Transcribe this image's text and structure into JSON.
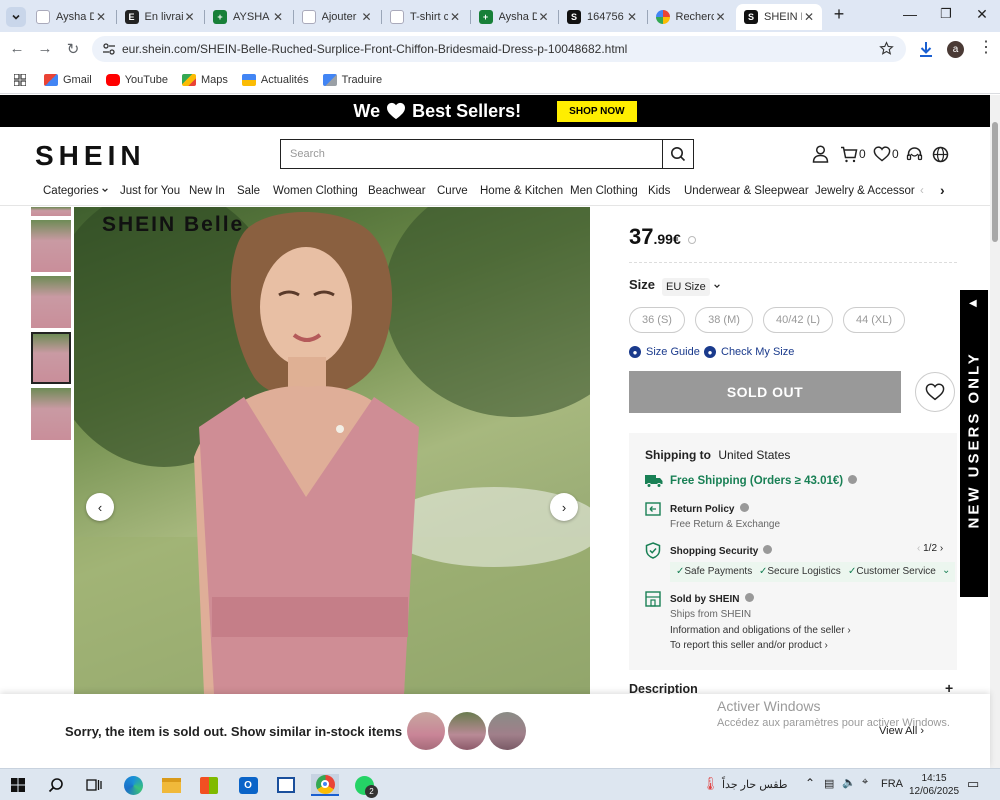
{
  "browser": {
    "tabs": [
      {
        "title": "Aysha D",
        "icon": "pg"
      },
      {
        "title": "En livrai",
        "icon": "e"
      },
      {
        "title": "AYSHA |",
        "icon": "sheet"
      },
      {
        "title": "Ajouter",
        "icon": "pg"
      },
      {
        "title": "T-shirt c",
        "icon": "pg"
      },
      {
        "title": "Aysha D",
        "icon": "sheet"
      },
      {
        "title": "164756",
        "icon": "s"
      },
      {
        "title": "Recherc",
        "icon": "g"
      },
      {
        "title": "SHEIN B",
        "icon": "s"
      }
    ],
    "new_tab": "+",
    "url": "eur.shein.com/SHEIN-Belle-Ruched-Surplice-Front-Chiffon-Bridesmaid-Dress-p-10048682.html",
    "profile_initial": "a",
    "bookmarks": [
      "Gmail",
      "YouTube",
      "Maps",
      "Actualités",
      "Traduire"
    ]
  },
  "promo": {
    "prefix": "We",
    "suffix": "Best Sellers!",
    "button": "SHOP NOW"
  },
  "header": {
    "logo": "SHEIN",
    "search_placeholder": "Search",
    "cart_count": "0",
    "wishlist_count": "0"
  },
  "categories": [
    "Categories",
    "Just for You",
    "New In",
    "Sale",
    "Women Clothing",
    "Beachwear",
    "Curve",
    "Home & Kitchen",
    "Men Clothing",
    "Kids",
    "Underwear & Sleepwear",
    "Jewelry & Accessories"
  ],
  "gallery": {
    "brand_overlay": "SHEIN Belle"
  },
  "product": {
    "price_main": "37",
    "price_cents": ".99€",
    "size_label": "Size",
    "size_system": "EU Size",
    "sizes": [
      "36 (S)",
      "38 (M)",
      "40/42 (L)",
      "44 (XL)"
    ],
    "size_guide": "Size Guide",
    "check_size": "Check My Size",
    "sold_out": "SOLD OUT",
    "description": "Description"
  },
  "shipping": {
    "label": "Shipping to",
    "country": "United States",
    "free_shipping": "Free Shipping (Orders ≥ 43.01€)",
    "return_policy": "Return Policy",
    "return_detail": "Free Return & Exchange",
    "security": "Shopping Security",
    "pager": "1/2",
    "security_items": [
      "Safe Payments",
      "Secure Logistics",
      "Customer Service"
    ],
    "sold_by": "Sold by SHEIN",
    "ships_from": "Ships from SHEIN",
    "obligations": "Information and obligations of the seller",
    "report": "To report this seller and/or product"
  },
  "side_banner": "NEW USERS ONLY",
  "sold_bar": {
    "message": "Sorry, the item is sold out. Show similar in-stock items",
    "view_all": "View All"
  },
  "watermark": {
    "title": "Activer Windows",
    "subtitle": "Accédez aux paramètres pour activer Windows."
  },
  "taskbar": {
    "whatsapp_badge": "2",
    "weather": "طقس حار جداً",
    "language": "FRA",
    "time": "14:15",
    "date": "12/06/2025"
  },
  "colors": {
    "free_shipping": "#198055",
    "link": "#1a3a8c",
    "promo_button": "#ffee00"
  }
}
